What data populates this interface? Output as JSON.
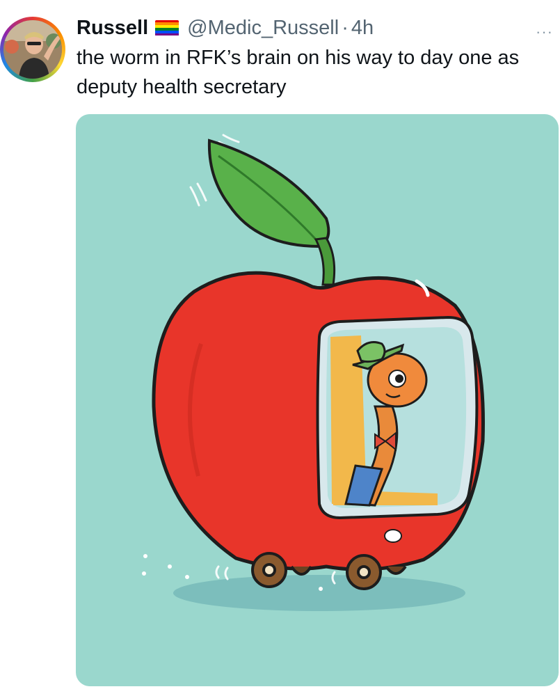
{
  "tweet": {
    "display_name": "Russell",
    "flag_icon": "rainbow-flag-icon",
    "handle": "@Medic_Russell",
    "separator": "·",
    "time": "4h",
    "more_icon": "···",
    "text": "the worm in RFK’s brain on his way to day one as deputy health secretary"
  },
  "colors": {
    "text": "#0f1419",
    "secondary": "#536471",
    "media_bg": "#9ad7cd",
    "apple_red": "#e8352a"
  }
}
